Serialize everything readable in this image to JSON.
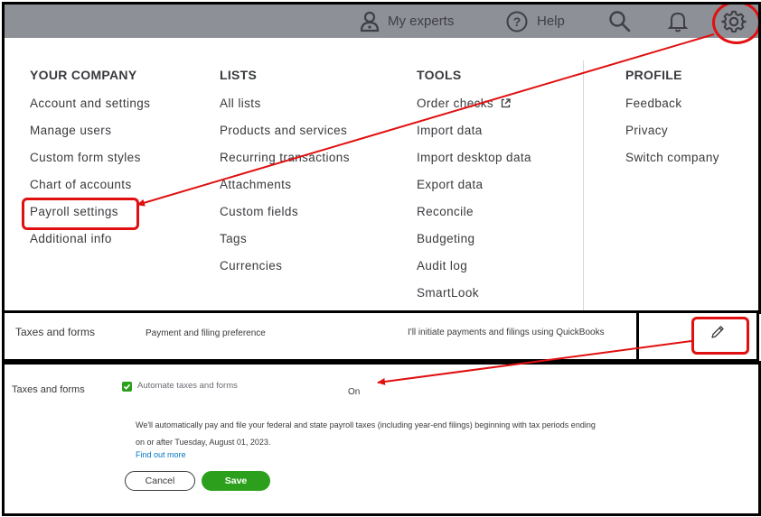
{
  "topbar": {
    "my_experts": "My experts",
    "help": "Help"
  },
  "menu": {
    "your_company": {
      "heading": "YOUR COMPANY",
      "items": [
        "Account and settings",
        "Manage users",
        "Custom form styles",
        "Chart of accounts",
        "Payroll settings",
        "Additional info"
      ]
    },
    "lists": {
      "heading": "LISTS",
      "items": [
        "All lists",
        "Products and services",
        "Recurring transactions",
        "Attachments",
        "Custom fields",
        "Tags",
        "Currencies"
      ]
    },
    "tools": {
      "heading": "TOOLS",
      "items": [
        "Order checks",
        "Import data",
        "Import desktop data",
        "Export data",
        "Reconcile",
        "Budgeting",
        "Audit log",
        "SmartLook"
      ]
    },
    "profile": {
      "heading": "PROFILE",
      "items": [
        "Feedback",
        "Privacy",
        "Switch company"
      ]
    }
  },
  "taxes_summary": {
    "title": "Taxes and forms",
    "label": "Payment and filing preference",
    "value": "I'll initiate payments and filings using QuickBooks"
  },
  "taxes_edit": {
    "title": "Taxes and forms",
    "checkbox_label": "Automate taxes and forms",
    "status": "On",
    "description": "We'll automatically pay and file your federal and state payroll taxes (including year-end filings) beginning with tax periods ending on or after Tuesday, August 01, 2023.",
    "link": "Find out more",
    "cancel": "Cancel",
    "save": "Save"
  },
  "colors": {
    "accent_green": "#2ca01c",
    "annotation_red": "#e01010",
    "topbar_gray": "#8d9096",
    "link_blue": "#0077c5"
  }
}
